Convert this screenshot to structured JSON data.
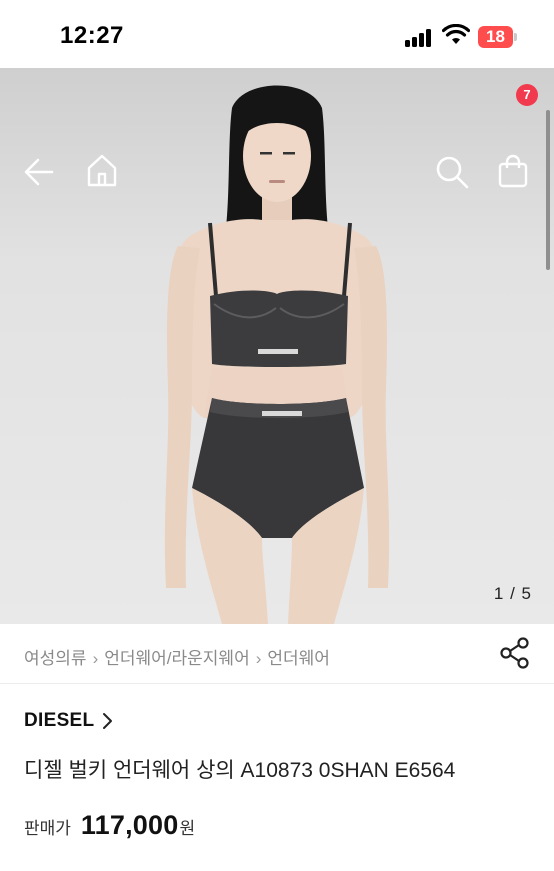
{
  "status_bar": {
    "time": "12:27",
    "battery_level": "18"
  },
  "nav": {
    "back_icon": "arrow-left-icon",
    "home_icon": "home-icon",
    "search_icon": "search-icon",
    "cart_icon": "shopping-bag-icon",
    "cart_count": "7"
  },
  "gallery": {
    "pager": "1 / 5"
  },
  "breadcrumb": {
    "items": [
      "여성의류",
      "언더웨어/라운지웨어",
      "언더웨어"
    ]
  },
  "share_icon": "share-icon",
  "product": {
    "brand": "DIESEL",
    "title": "디젤 벌키 언더웨어 상의 A10873 0SHAN E6564",
    "price_label": "판매가",
    "price": "117,000",
    "price_unit": "원"
  },
  "colors": {
    "badge": "#f23a4f",
    "battery": "#ff4d4d"
  }
}
